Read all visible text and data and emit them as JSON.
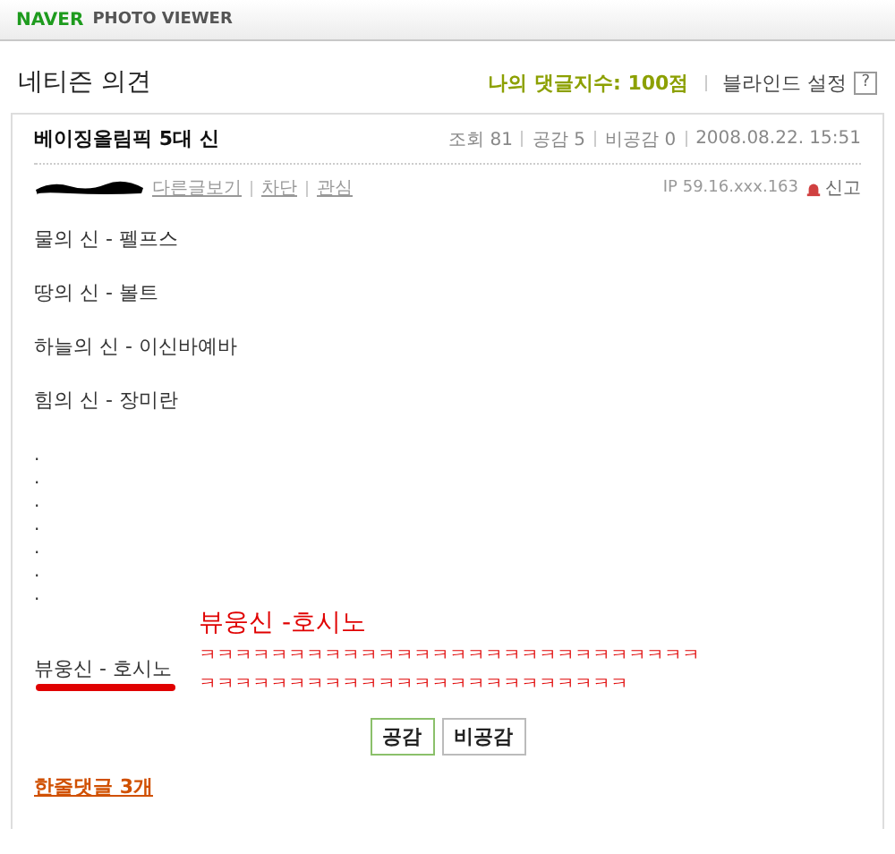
{
  "header": {
    "logo": "NAVER",
    "title": "PHOTO VIEWER"
  },
  "section": {
    "title": "네티즌 의견",
    "score": "나의 댓글지수: 100점",
    "blind": "블라인드 설정",
    "help": "?"
  },
  "post": {
    "title": "베이징올림픽 5대 신",
    "stats": [
      "조회 81",
      "공감 5",
      "비공감 0",
      "2008.08.22. 15:51"
    ],
    "links": [
      "다른글보기",
      "차단",
      "관심"
    ],
    "ip": "IP 59.16.xxx.163",
    "report": "신고",
    "lines": [
      "물의 신 - 펠프스",
      "땅의 신 - 볼트",
      "하늘의 신 - 이신바예바",
      "힘의 신 - 장미란"
    ],
    "dots": [
      ".",
      ".",
      ".",
      ".",
      ".",
      ".",
      "."
    ],
    "last_line": "뷰웅신 - 호시노",
    "annotation": {
      "title": "뷰웅신 -호시노",
      "lines": [
        "ㅋㅋㅋㅋㅋㅋㅋㅋㅋㅋㅋㅋㅋㅋㅋㅋㅋㅋㅋㅋㅋㅋㅋㅋㅋㅋㅋㅋ",
        "ㅋㅋㅋㅋㅋㅋㅋㅋㅋㅋㅋㅋㅋㅋㅋㅋㅋㅋㅋㅋㅋㅋㅋㅋ"
      ]
    },
    "buttons": [
      {
        "label": "공감",
        "selected": true
      },
      {
        "label": "비공감",
        "selected": false
      }
    ],
    "comments_link": "한줄댓글 3개"
  }
}
